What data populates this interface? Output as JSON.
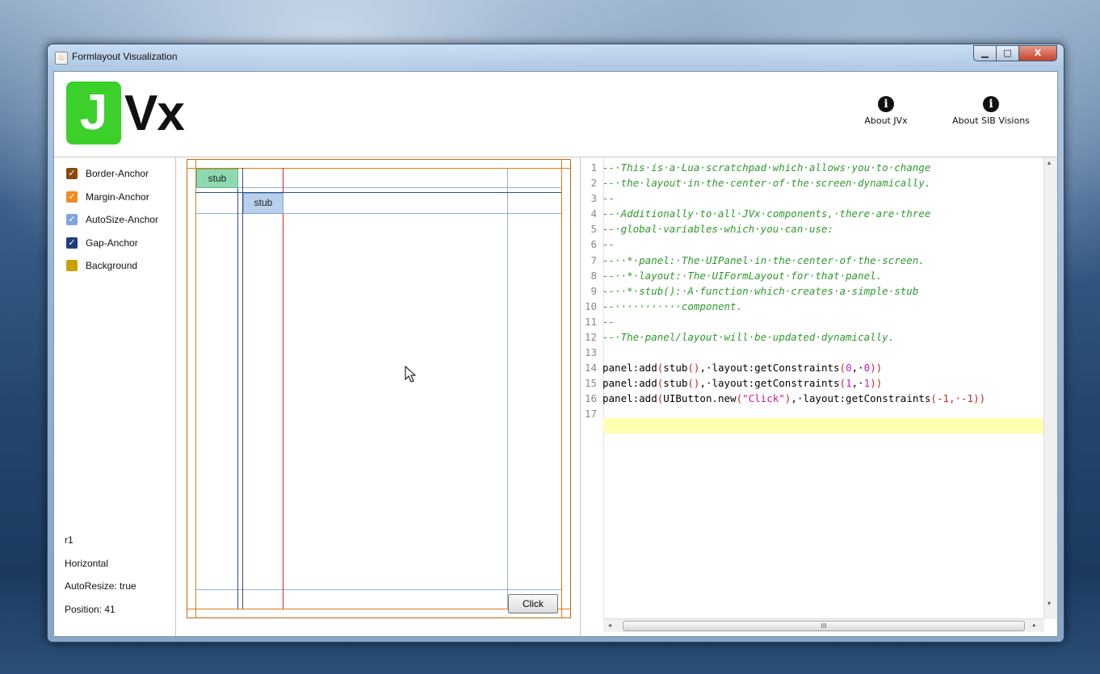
{
  "window": {
    "title": "Formlayout Visualization",
    "minimize_symbol": "▁",
    "maximize_symbol": "□",
    "close_symbol": "X"
  },
  "header": {
    "logo_letter": "J",
    "logo_text": "Vx",
    "about_jvx_label": "About JVx",
    "about_sib_label": "About SIB Visions",
    "info_glyph": "i"
  },
  "legend": {
    "items": [
      {
        "label": "Border-Anchor",
        "color": "#8a4a0e",
        "checked": true
      },
      {
        "label": "Margin-Anchor",
        "color": "#f08c1e",
        "checked": true
      },
      {
        "label": "AutoSize-Anchor",
        "color": "#7ea7d8",
        "checked": true
      },
      {
        "label": "Gap-Anchor",
        "color": "#1c3f7a",
        "checked": true
      },
      {
        "label": "Background",
        "color": "#c9a100",
        "checked": false
      }
    ]
  },
  "anchor_info": {
    "name": "r1",
    "orientation": "Horizontal",
    "autoresize": "AutoResize: true",
    "position": "Position: 41"
  },
  "canvas": {
    "stub1_label": "stub",
    "stub2_label": "stub",
    "button_label": "Click"
  },
  "editor": {
    "lines": [
      {
        "n": "1",
        "text": "--·This·is·a·Lua·scratchpad·which·allows·you·to·change"
      },
      {
        "n": "2",
        "text": "--·the·layout·in·the·center·of·the·screen·dynamically."
      },
      {
        "n": "3",
        "text": "--"
      },
      {
        "n": "4",
        "text": "--·Additionally·to·all·JVx·components,·there·are·three"
      },
      {
        "n": "5",
        "text": "--·global·variables·which·you·can·use:"
      },
      {
        "n": "6",
        "text": "--"
      },
      {
        "n": "7",
        "text": "--··*·panel:·The·UIPanel·in·the·center·of·the·screen."
      },
      {
        "n": "8",
        "text": "--··*·layout:·The·UIFormLayout·for·that·panel."
      },
      {
        "n": "9",
        "text": "--··*·stub():·A·function·which·creates·a·simple·stub"
      },
      {
        "n": "10",
        "text": "--···········component."
      },
      {
        "n": "11",
        "text": "--"
      },
      {
        "n": "12",
        "text": "--·The·panel/layout·will·be·updated·dynamically."
      },
      {
        "n": "13",
        "text": ""
      },
      {
        "n": "14",
        "text": "panel:add(stub(),·layout:getConstraints(0,·0))"
      },
      {
        "n": "15",
        "text": "panel:add(stub(),·layout:getConstraints(1,·1))"
      },
      {
        "n": "16",
        "text": "panel:add(UIButton.new(\"Click\"),·layout:getConstraints(-1,·-1))"
      },
      {
        "n": "17",
        "text": ""
      }
    ],
    "line14_parts": [
      "panel:add",
      "(",
      "stub",
      "()",
      ",·layout:getConstraints",
      "(",
      "0",
      ",·",
      "0",
      "))"
    ],
    "line15_parts": [
      "panel:add",
      "(",
      "stub",
      "()",
      ",·layout:getConstraints",
      "(",
      "1",
      ",·",
      "1",
      "))"
    ],
    "line16_parts": [
      "panel:add",
      "(",
      "UIButton.new",
      "(",
      "\"Click\"",
      ")",
      ",·layout:getConstraints",
      "(-1,·-1)",
      ")"
    ],
    "hscroll_grip": "III",
    "scroll_left": "◂",
    "scroll_right": "▸",
    "scroll_up": "▴",
    "scroll_down": "▾"
  },
  "colors": {
    "border_anchor": "#c36a0c",
    "margin_anchor": "#e07a10",
    "autosize_anchor": "#8fb2d8",
    "gap_anchor": "#2a4f8a",
    "selected_anchor": "#e02020",
    "stub1_bg": "#8fd9b1",
    "stub2_bg": "#b8d0ec",
    "comment": "#2e9a2e"
  }
}
